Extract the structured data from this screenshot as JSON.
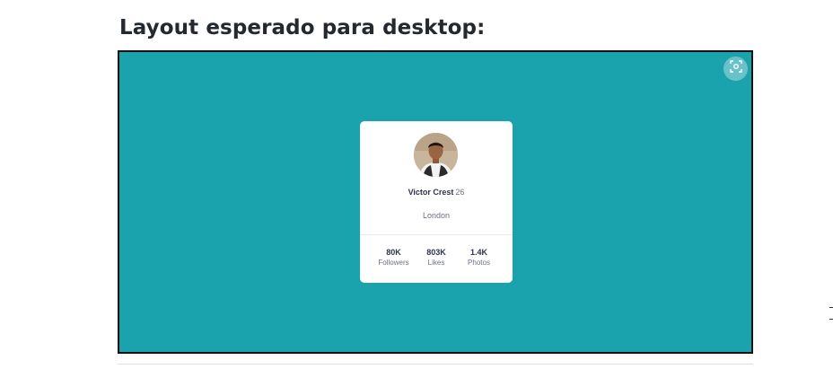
{
  "heading": "Layout esperado para desktop:",
  "preview": {
    "background_color": "#1aa2ad",
    "zoom_icon": "expand-screen-icon"
  },
  "profile_card": {
    "avatar_icon": "user-avatar-photo",
    "name": "Victor Crest",
    "age": "26",
    "location": "London",
    "stats": [
      {
        "value": "80K",
        "label": "Followers"
      },
      {
        "value": "803K",
        "label": "Likes"
      },
      {
        "value": "1.4K",
        "label": "Photos"
      }
    ]
  }
}
